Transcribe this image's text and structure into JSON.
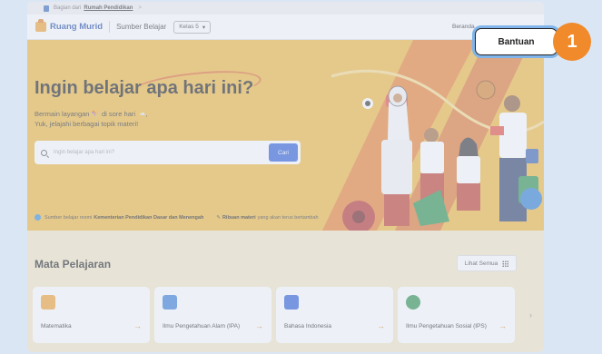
{
  "topbar": {
    "prefix": "Bagian dari",
    "link": "Rumah Pendidikan",
    "chevron": ">"
  },
  "nav": {
    "brand": "Ruang Murid",
    "source": "Sumber Belajar",
    "kelas": "Kelas 5",
    "beranda": "Beranda"
  },
  "hero": {
    "title": "Ingin belajar apa hari ini?",
    "sub1": "Bermain layangan 🪁 di sore hari 🌤️,",
    "sub2": "Yuk, jelajahi berbagai topik materi!",
    "search_placeholder": "Ingin belajar apa hari ini?",
    "search_button": "Cari",
    "foot1_pre": "Sumber belajar resmi",
    "foot1_bold": "Kementerian Pendidikan Dasar dan Menengah",
    "foot2_bold": "Ribuan materi",
    "foot2_post": "yang akan terus bertambah"
  },
  "subjects": {
    "title": "Mata Pelajaran",
    "see_all": "Lihat Semua",
    "items": [
      {
        "name": "Matematika",
        "icon": "calculator-icon",
        "color": "#f0a030"
      },
      {
        "name": "Ilmu Pengetahuan Alam (IPA)",
        "icon": "plant-icon",
        "color": "#3a7bd5"
      },
      {
        "name": "Bahasa Indonesia",
        "icon": "book-icon",
        "color": "#2a5bd6"
      },
      {
        "name": "Ilmu Pengetahuan Sosial (IPS)",
        "icon": "globe-icon",
        "color": "#2a8f4a"
      }
    ]
  },
  "callout": {
    "label": "Bantuan",
    "badge": "1"
  },
  "colors": {
    "hero_bg": "#f1b73b",
    "accent": "#f08a2a",
    "primary": "#2a5bd6"
  }
}
